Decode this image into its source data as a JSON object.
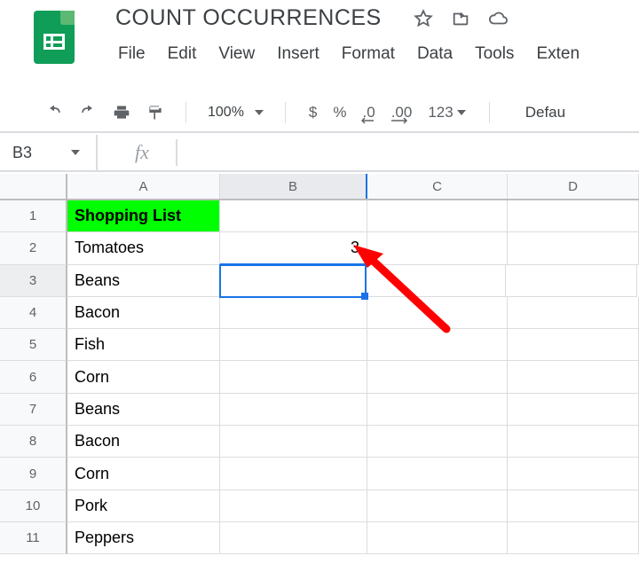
{
  "doc_title": "COUNT OCCURRENCES",
  "menu": {
    "file": "File",
    "edit": "Edit",
    "view": "View",
    "insert": "Insert",
    "format": "Format",
    "data": "Data",
    "tools": "Tools",
    "extensions": "Exten"
  },
  "toolbar": {
    "zoom": "100%",
    "currency": "$",
    "percent": "%",
    "dec_less": ".0",
    "dec_more": ".00",
    "num_format": "123",
    "font": "Defau"
  },
  "namebox": {
    "cell_ref": "B3",
    "fx_label": "fx"
  },
  "columns": {
    "A": "A",
    "B": "B",
    "C": "C",
    "D": "D"
  },
  "rows": {
    "r1": "1",
    "r2": "2",
    "r3": "3",
    "r4": "4",
    "r5": "5",
    "r6": "6",
    "r7": "7",
    "r8": "8",
    "r9": "9",
    "r10": "10",
    "r11": "11"
  },
  "cells": {
    "A1": "Shopping List",
    "A2": "Tomatoes",
    "A3": "Beans",
    "A4": "Bacon",
    "A5": "Fish",
    "A6": "Corn",
    "A7": "Beans",
    "A8": "Bacon",
    "A9": "Corn",
    "A10": "Pork",
    "A11": "Peppers",
    "B2": "3"
  },
  "selection": {
    "active_cell": "B3"
  }
}
